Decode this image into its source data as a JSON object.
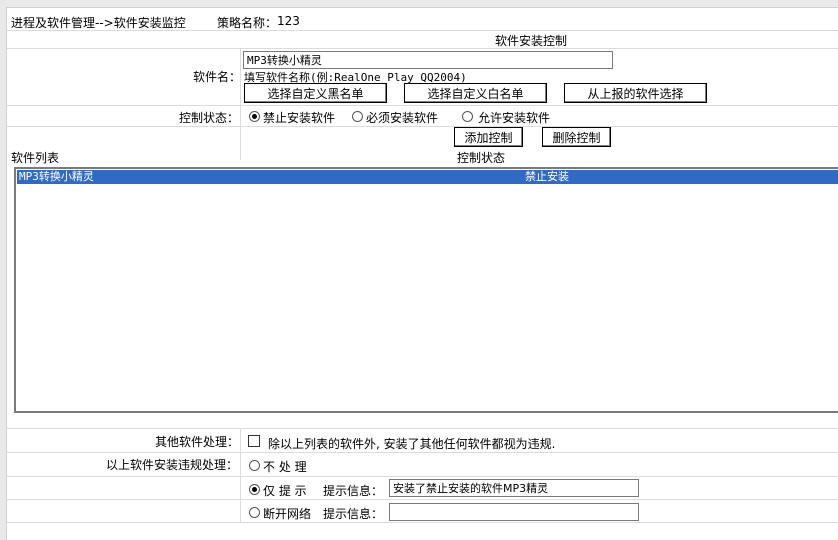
{
  "breadcrumb": "进程及软件管理-->软件安装监控",
  "policy": {
    "label": "策略名称：",
    "value": "123"
  },
  "section_title": "软件安装控制",
  "software_name": {
    "label": "软件名：",
    "value": "MP3转换小精灵",
    "hint": "填写软件名称(例:RealOne Play QQ2004)"
  },
  "buttons": {
    "blacklist": "选择自定义黑名单",
    "whitelist": "选择自定义白名单",
    "reported": "从上报的软件选择",
    "add": "添加控制",
    "delete": "删除控制"
  },
  "control_state": {
    "label": "控制状态：",
    "options": [
      "禁止安装软件",
      "必须安装软件",
      "允许安装软件"
    ],
    "selected": "禁止安装软件"
  },
  "list": {
    "columns": [
      "软件列表",
      "控制状态"
    ],
    "rows": [
      {
        "name": "MP3转换小精灵",
        "state": "禁止安装",
        "selected": true
      }
    ]
  },
  "other_software": {
    "label": "其他软件处理：",
    "checkbox_text": "除以上列表的软件外, 安装了其他任何软件都视为违规.",
    "checked": false
  },
  "violation": {
    "label": "以上软件安装违规处理：",
    "options": [
      "不 处 理",
      "仅 提 示",
      "断开网络"
    ],
    "selected": "仅 提 示",
    "hint_label": "提示信息：",
    "hint_value_prompt": "安装了禁止安装的软件MP3精灵",
    "hint_value_disconnect": ""
  },
  "colors": {
    "selection": "#316ac5",
    "background": "#e9e9e9"
  }
}
